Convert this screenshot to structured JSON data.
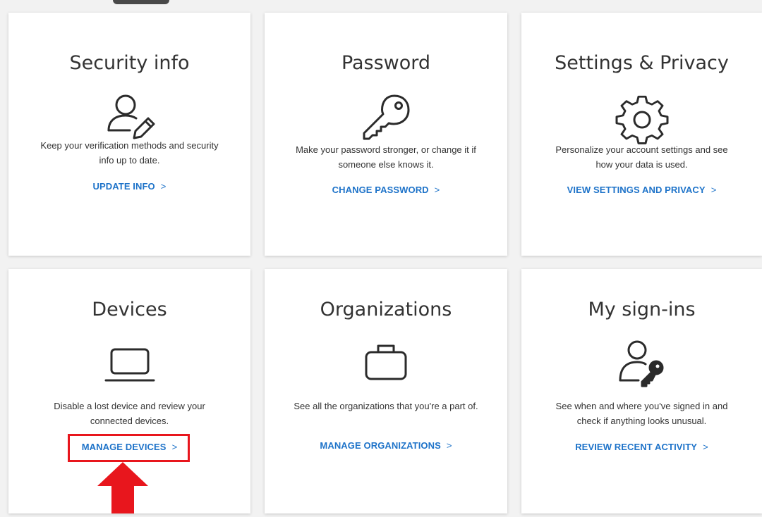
{
  "cards": [
    {
      "title": "Security info",
      "icon": "user-edit-icon",
      "desc_line1": "Keep your verification methods and security",
      "desc_line2": "info up to date.",
      "link": "UPDATE INFO"
    },
    {
      "title": "Password",
      "icon": "key-icon",
      "desc_line1": "Make your password stronger, or change it if",
      "desc_line2": "someone else knows it.",
      "link": "CHANGE PASSWORD"
    },
    {
      "title": "Settings & Privacy",
      "icon": "gear-icon",
      "desc_line1": "Personalize your account settings and see",
      "desc_line2": "how your data is used.",
      "link": "VIEW SETTINGS AND PRIVACY"
    },
    {
      "title": "Devices",
      "icon": "laptop-icon",
      "desc_line1": "Disable a lost device and review your",
      "desc_line2": "connected devices.",
      "link": "MANAGE DEVICES"
    },
    {
      "title": "Organizations",
      "icon": "briefcase-icon",
      "desc_line1": "See all the organizations that you're a part of.",
      "desc_line2": "",
      "link": "MANAGE ORGANIZATIONS"
    },
    {
      "title": "My sign-ins",
      "icon": "user-key-icon",
      "desc_line1": "See when and where you've signed in and",
      "desc_line2": "check if anything looks unusual.",
      "link": "REVIEW RECENT ACTIVITY"
    }
  ],
  "chevron": ">",
  "colors": {
    "link": "#1e73c9",
    "highlight": "#e8161d",
    "background": "#f2f2f2",
    "card": "#ffffff"
  }
}
